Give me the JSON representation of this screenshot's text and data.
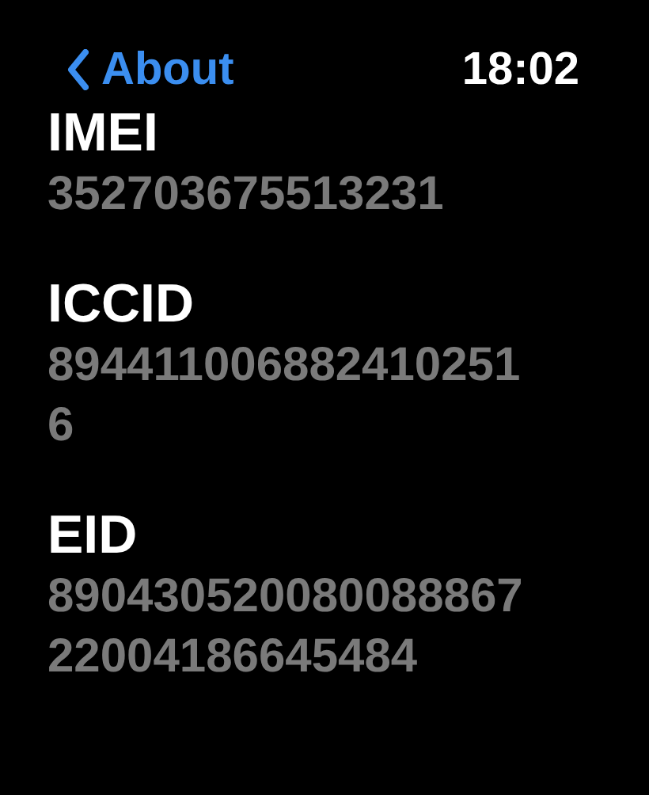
{
  "header": {
    "back_label": "About",
    "time": "18:02"
  },
  "fields": [
    {
      "label": "IMEI",
      "value": "352703675513231"
    },
    {
      "label": "ICCID",
      "value": "8944110068824102516"
    },
    {
      "label": "EID",
      "value": "89043052008008886722004186645484"
    }
  ]
}
